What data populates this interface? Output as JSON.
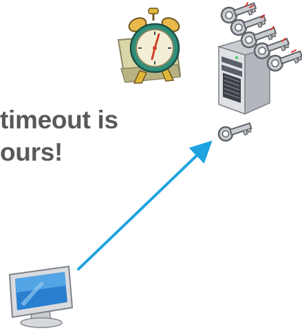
{
  "caption": {
    "line1": "timeout is",
    "line2": "ours!"
  },
  "icons": {
    "clock": "alarm-clock-icon",
    "server": "server-tower-icon",
    "keys": "key-icon",
    "computer": "desktop-computer-icon",
    "arrow": "request-arrow"
  },
  "colors": {
    "caption_text": "#595959",
    "arrow": "#1fa3e0",
    "clock_body": "#2f8f7a",
    "key_metal": "#c9ccd0",
    "server_body": "#d8dadd",
    "screen_blue": "#2a7fd0"
  }
}
